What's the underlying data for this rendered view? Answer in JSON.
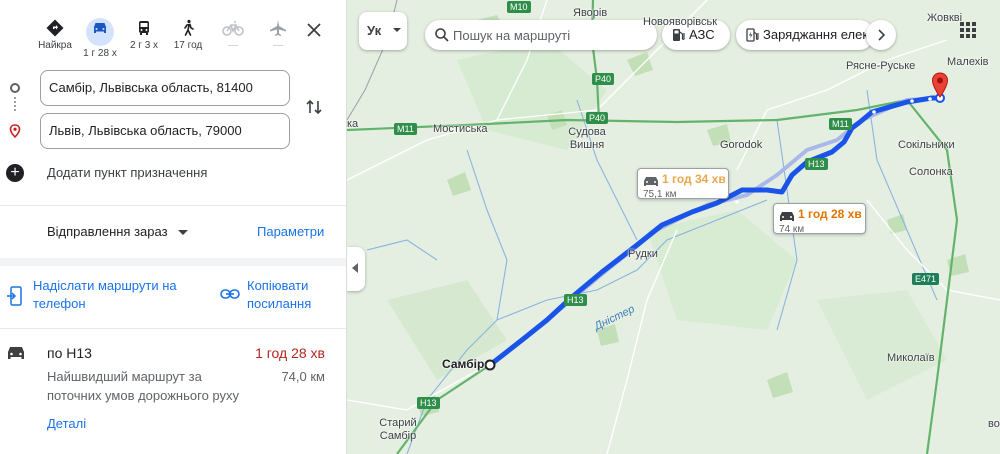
{
  "modes": [
    {
      "label": "Найкра",
      "icon": "best-route-icon"
    },
    {
      "label": "1 г 28 х",
      "icon": "car-icon"
    },
    {
      "label": "2 г 3 х",
      "icon": "bus-icon"
    },
    {
      "label": "17 год",
      "icon": "walk-icon"
    },
    {
      "label": "—",
      "icon": "bike-icon"
    },
    {
      "label": "—",
      "icon": "plane-icon"
    }
  ],
  "origin": "Самбір, Львівська область, 81400",
  "destination": "Львів, Львівська область, 79000",
  "add_destination_label": "Додати пункт призначення",
  "departure_label": "Відправлення зараз",
  "options_label": "Параметри",
  "send_to_phone_label": "Надіслати маршрути на телефон",
  "copy_link_label": "Копіювати посилання",
  "route": {
    "via": "по Н13",
    "duration": "1 год 28 хв",
    "description": "Найшвидший маршрут за поточних умов дорожнього руху",
    "distance": "74,0 км",
    "details_label": "Деталі"
  },
  "map": {
    "layer_label": "Ук",
    "search_placeholder": "Пошук на маршруті",
    "chip_gas": "АЗС",
    "chip_charging": "Заряджання електромобілів",
    "bubble_primary": {
      "time": "1 год 28 хв",
      "distance": "74 км"
    },
    "bubble_alt": {
      "time": "1 год 34 хв",
      "distance": "75,1 км"
    },
    "places": {
      "yavoriv": "Яворів",
      "novoyavorivsk": "Новояворівськ",
      "zhovkiv": "Жовкві",
      "rysne_ruske": "Рясне-Руське",
      "malekhiv": "Малехів",
      "mostyska": "Мостиська",
      "sudova_vyshnia": "Судова Вишня",
      "horodok": "Gorodok",
      "sokilnyky": "Сокільники",
      "solonka": "Солонка",
      "rudky": "Рудки",
      "dnister": "Дністер",
      "sambir": "Самбір",
      "staryi_sambir": "Старий Самбір",
      "mykolaiv": "Миколаїв",
      "ka": "ка",
      "vo": "во"
    },
    "roads": {
      "m10": "M10",
      "p40": "P40",
      "p40b": "P40",
      "m11": "M11",
      "m11b": "M11",
      "h13a": "H13",
      "h13b": "H13",
      "h13c": "H13",
      "e471": "E471"
    }
  },
  "colors": {
    "accent": "#1a73e8",
    "route_line": "#1a53e8",
    "duration_red": "#b3261e",
    "traffic_orange": "#e37400"
  }
}
